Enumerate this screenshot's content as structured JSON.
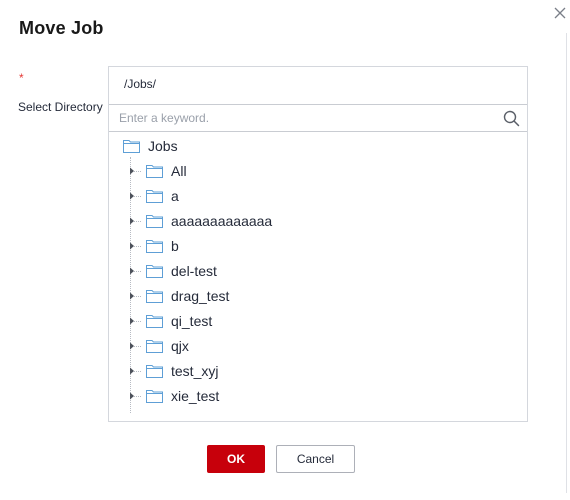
{
  "dialog": {
    "title": "Move Job",
    "required_mark": "*",
    "label": "Select Directory",
    "current_path": "/Jobs/",
    "search": {
      "placeholder": "Enter a keyword.",
      "value": ""
    },
    "tree": {
      "root": "Jobs",
      "children": [
        "All",
        "a",
        "aaaaaaaaaaaaa",
        "b",
        "del-test",
        "drag_test",
        "qi_test",
        "qjx",
        "test_xyj",
        "xie_test"
      ]
    },
    "buttons": {
      "ok": "OK",
      "cancel": "Cancel"
    }
  },
  "colors": {
    "primary": "#c7000b",
    "folder": "#5e9fd6",
    "required": "#e53935"
  },
  "icons": {
    "close": "close-icon",
    "search": "search-icon",
    "folder": "folder-icon",
    "expand": "caret-right-icon"
  }
}
